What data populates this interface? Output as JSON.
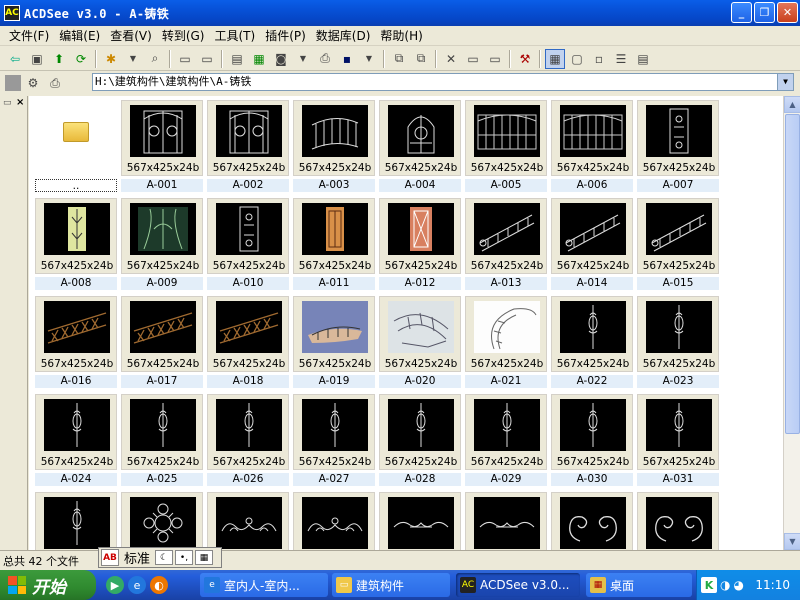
{
  "window": {
    "title": "ACDSee v3.0 - A-铸铁",
    "icon_name": "acdsee-app-icon"
  },
  "menu": [
    "文件(F)",
    "编辑(E)",
    "查看(V)",
    "转到(G)",
    "工具(T)",
    "插件(P)",
    "数据库(D)",
    "帮助(H)"
  ],
  "address": {
    "path": "H:\\建筑构件\\建筑构件\\A-铸铁"
  },
  "folder_item": {
    "label": ".."
  },
  "thumbnails": [
    {
      "label": "A-001",
      "dims": "567x425x24b",
      "art": "gate"
    },
    {
      "label": "A-002",
      "dims": "567x425x24b",
      "art": "gate"
    },
    {
      "label": "A-003",
      "dims": "567x425x24b",
      "art": "railing"
    },
    {
      "label": "A-004",
      "dims": "567x425x24b",
      "art": "arch"
    },
    {
      "label": "A-005",
      "dims": "567x425x24b",
      "art": "fence"
    },
    {
      "label": "A-006",
      "dims": "567x425x24b",
      "art": "fence"
    },
    {
      "label": "A-007",
      "dims": "567x425x24b",
      "art": "door"
    },
    {
      "label": "A-008",
      "dims": "567x425x24b",
      "art": "panel-yellow"
    },
    {
      "label": "A-009",
      "dims": "567x425x24b",
      "art": "panel-green"
    },
    {
      "label": "A-010",
      "dims": "567x425x24b",
      "art": "door"
    },
    {
      "label": "A-011",
      "dims": "567x425x24b",
      "art": "panel-orange"
    },
    {
      "label": "A-012",
      "dims": "567x425x24b",
      "art": "panel-red"
    },
    {
      "label": "A-013",
      "dims": "567x425x24b",
      "art": "stair"
    },
    {
      "label": "A-014",
      "dims": "567x425x24b",
      "art": "stair"
    },
    {
      "label": "A-015",
      "dims": "567x425x24b",
      "art": "stair"
    },
    {
      "label": "A-016",
      "dims": "567x425x24b",
      "art": "rail-brown"
    },
    {
      "label": "A-017",
      "dims": "567x425x24b",
      "art": "rail-brown"
    },
    {
      "label": "A-018",
      "dims": "567x425x24b",
      "art": "rail-brown"
    },
    {
      "label": "A-019",
      "dims": "567x425x24b",
      "art": "render-blue"
    },
    {
      "label": "A-020",
      "dims": "567x425x24b",
      "art": "render-grey"
    },
    {
      "label": "A-021",
      "dims": "567x425x24b",
      "art": "render-white"
    },
    {
      "label": "A-022",
      "dims": "567x425x24b",
      "art": "baluster"
    },
    {
      "label": "A-023",
      "dims": "567x425x24b",
      "art": "baluster"
    },
    {
      "label": "A-024",
      "dims": "567x425x24b",
      "art": "baluster"
    },
    {
      "label": "A-025",
      "dims": "567x425x24b",
      "art": "baluster"
    },
    {
      "label": "A-026",
      "dims": "567x425x24b",
      "art": "baluster"
    },
    {
      "label": "A-027",
      "dims": "567x425x24b",
      "art": "baluster"
    },
    {
      "label": "A-028",
      "dims": "567x425x24b",
      "art": "baluster"
    },
    {
      "label": "A-029",
      "dims": "567x425x24b",
      "art": "baluster"
    },
    {
      "label": "A-030",
      "dims": "567x425x24b",
      "art": "baluster"
    },
    {
      "label": "A-031",
      "dims": "567x425x24b",
      "art": "baluster"
    },
    {
      "label": "",
      "dims": "",
      "art": "baluster"
    },
    {
      "label": "",
      "dims": "",
      "art": "rosette"
    },
    {
      "label": "",
      "dims": "",
      "art": "scroll"
    },
    {
      "label": "",
      "dims": "",
      "art": "scroll"
    },
    {
      "label": "",
      "dims": "",
      "art": "scroll-flat"
    },
    {
      "label": "",
      "dims": "",
      "art": "scroll-flat"
    },
    {
      "label": "",
      "dims": "",
      "art": "curl"
    },
    {
      "label": "",
      "dims": "",
      "art": "curl"
    }
  ],
  "status": {
    "text": "总共 42 个文件"
  },
  "ime": {
    "mode": "标准"
  },
  "taskbar": {
    "start": "开始",
    "tasks": [
      {
        "label": "室内人-室内...",
        "active": false
      },
      {
        "label": "建筑构件",
        "active": false
      },
      {
        "label": "ACDSee v3.0...",
        "active": true
      },
      {
        "label": "桌面",
        "active": false
      }
    ],
    "clock": "11:10"
  }
}
